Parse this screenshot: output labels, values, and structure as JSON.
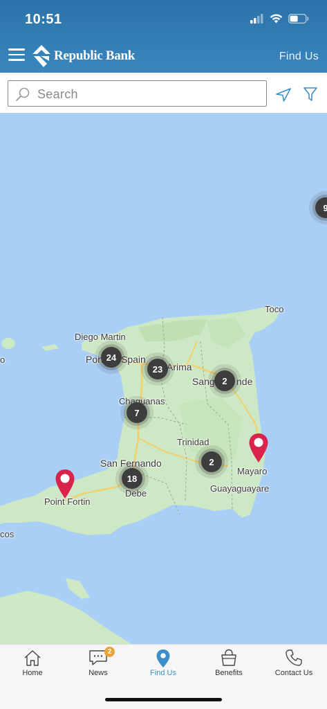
{
  "status": {
    "time": "10:51"
  },
  "header": {
    "brand": "Republic Bank",
    "right_link": "Find Us"
  },
  "search": {
    "placeholder": "Search"
  },
  "map": {
    "places": {
      "toco": "Toco",
      "diego_martin": "Diego Martin",
      "port_of_spain_left": "Port",
      "port_of_spain_right": "Spain",
      "arima": "Arima",
      "sangre_left": "Sangre",
      "sangre_right": "nde",
      "chaguanas": "Chaguanas",
      "trinidad": "Trinidad",
      "san_fernando": "San Fernando",
      "debe": "Debe",
      "mayaro": "Mayaro",
      "guayaguayare": "Guayaguayare",
      "point_fortin": "Point Fortin",
      "cedros_partial": "cos",
      "left_partial": "o"
    },
    "clusters": {
      "c24": "24",
      "c23": "23",
      "c2a": "2",
      "c7": "7",
      "c2b": "2",
      "c18": "18",
      "c9": "9"
    }
  },
  "tabs": [
    {
      "label": "Home",
      "icon": "home-icon"
    },
    {
      "label": "News",
      "icon": "news-icon",
      "badge": "2"
    },
    {
      "label": "Find Us",
      "icon": "location-pin-icon"
    },
    {
      "label": "Benefits",
      "icon": "shopping-bag-icon"
    },
    {
      "label": "Contact Us",
      "icon": "phone-icon"
    }
  ],
  "colors": {
    "header": "#2f7ab0",
    "active_tab": "#3a8fc8",
    "pin": "#d9234d",
    "badge": "#e8a33a",
    "water": "#a9cff6",
    "land": "#cde8c4"
  }
}
